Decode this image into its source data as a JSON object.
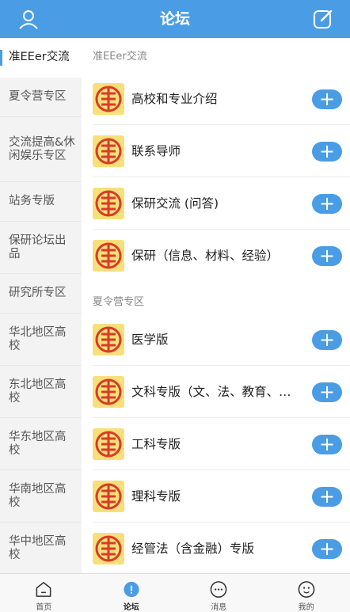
{
  "header": {
    "title": "论坛",
    "profile_icon": "user-icon",
    "compose_icon": "edit-icon"
  },
  "colors": {
    "accent": "#4a9de4",
    "logo_bg": "#f7e07a",
    "logo_fg": "#d93a2b"
  },
  "sidebar": {
    "items": [
      {
        "label": "准EEer交流",
        "active": true
      },
      {
        "label": "夏令营专区"
      },
      {
        "label": "交流提高&休闲娱乐专区"
      },
      {
        "label": "站务专版"
      },
      {
        "label": "保研论坛出品"
      },
      {
        "label": "研究所专区"
      },
      {
        "label": "华北地区高校"
      },
      {
        "label": "东北地区高校"
      },
      {
        "label": "华东地区高校"
      },
      {
        "label": "华南地区高校"
      },
      {
        "label": "华中地区高校"
      }
    ]
  },
  "sections": [
    {
      "title": "准EEer交流",
      "boards": [
        {
          "label": "高校和专业介绍"
        },
        {
          "label": "联系导师"
        },
        {
          "label": "保研交流 (问答)"
        },
        {
          "label": "保研（信息、材料、经验）"
        }
      ]
    },
    {
      "title": "夏令营专区",
      "boards": [
        {
          "label": "医学版"
        },
        {
          "label": "文科专版（文、法、教育、…"
        },
        {
          "label": "工科专版"
        },
        {
          "label": "理科专版"
        },
        {
          "label": "经管法（含金融）专版"
        }
      ]
    }
  ],
  "add_button_label": "+",
  "tabbar": {
    "tabs": [
      {
        "label": "首页",
        "icon": "home-icon"
      },
      {
        "label": "论坛",
        "icon": "forum-icon",
        "active": true
      },
      {
        "label": "消息",
        "icon": "message-icon"
      },
      {
        "label": "我的",
        "icon": "profile-face-icon"
      }
    ]
  }
}
